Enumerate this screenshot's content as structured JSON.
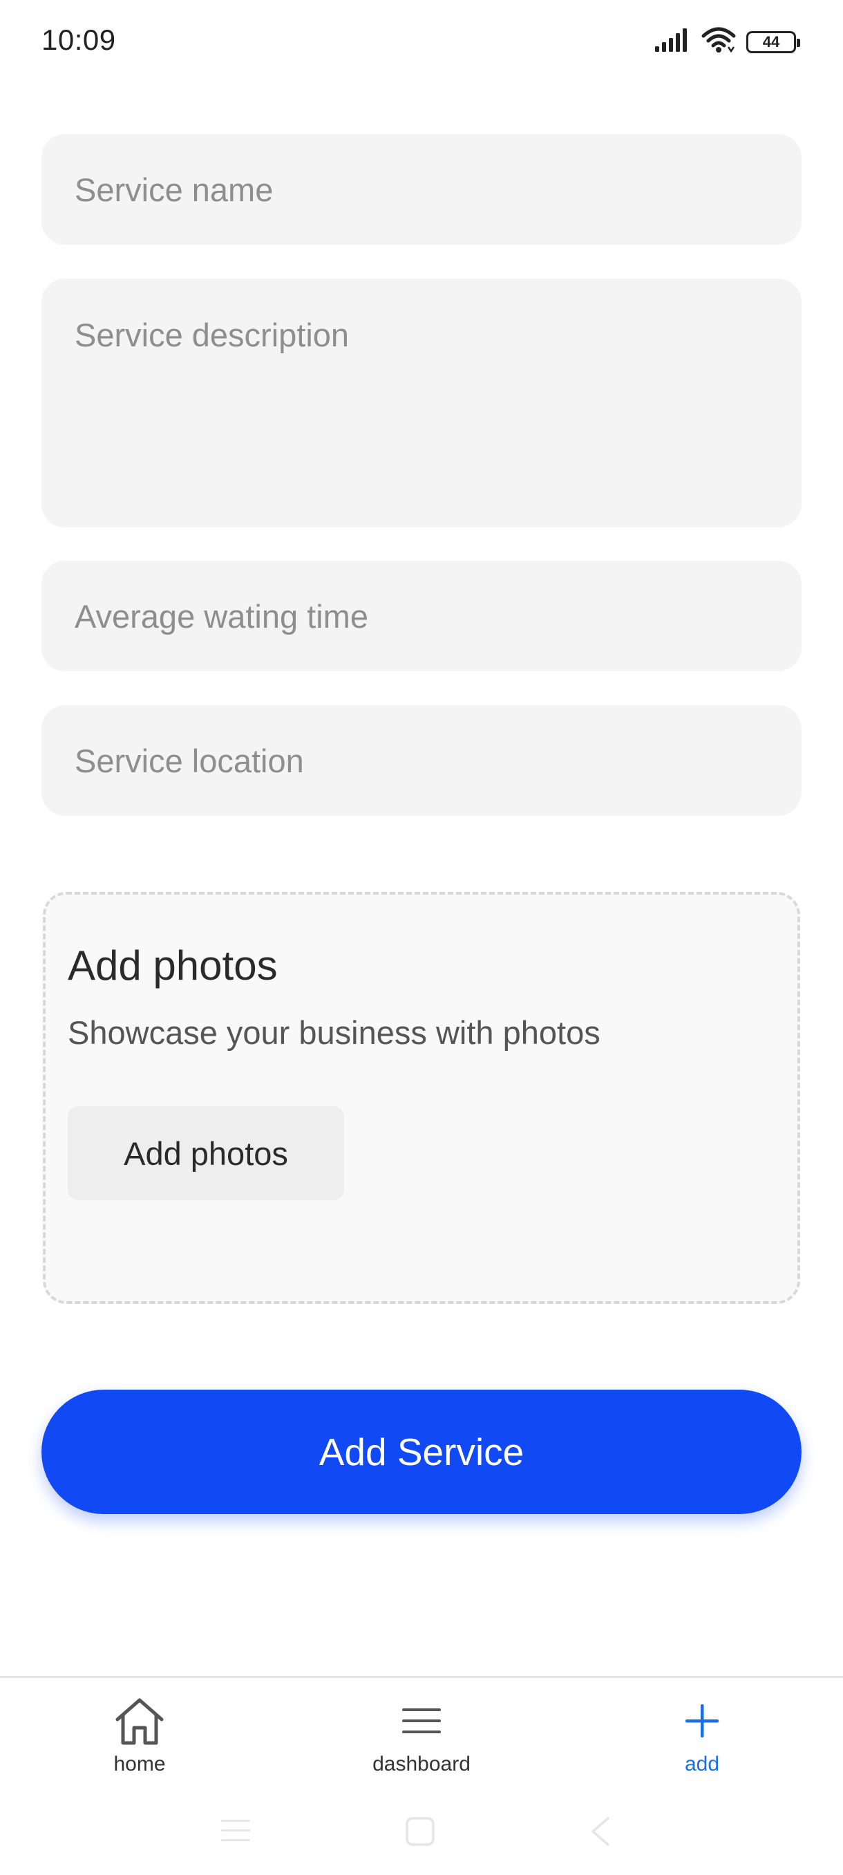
{
  "status_bar": {
    "time": "10:09",
    "battery_level": "44",
    "icons": [
      "signal-icon",
      "wifi-icon",
      "battery-icon"
    ]
  },
  "form": {
    "service_name": {
      "value": "",
      "placeholder": "Service name"
    },
    "service_description": {
      "value": "",
      "placeholder": "Service description"
    },
    "average_waiting_time": {
      "value": "",
      "placeholder": "Average wating time"
    },
    "service_location": {
      "value": "",
      "placeholder": "Service location"
    }
  },
  "photos": {
    "title": "Add photos",
    "subtitle": "Showcase your business with photos",
    "button_label": "Add photos"
  },
  "submit": {
    "label": "Add Service"
  },
  "bottom_nav": {
    "items": [
      {
        "label": "home",
        "icon": "home-icon",
        "active": false
      },
      {
        "label": "dashboard",
        "icon": "menu-icon",
        "active": false
      },
      {
        "label": "add",
        "icon": "plus-icon",
        "active": true
      }
    ]
  },
  "system_nav": {
    "icons": [
      "recent-apps-icon",
      "home-square-icon",
      "back-icon"
    ]
  },
  "colors": {
    "primary": "#1149f5",
    "active_nav": "#1a6fe0",
    "field_bg": "#f4f4f4",
    "placeholder": "#8e8e8e"
  }
}
